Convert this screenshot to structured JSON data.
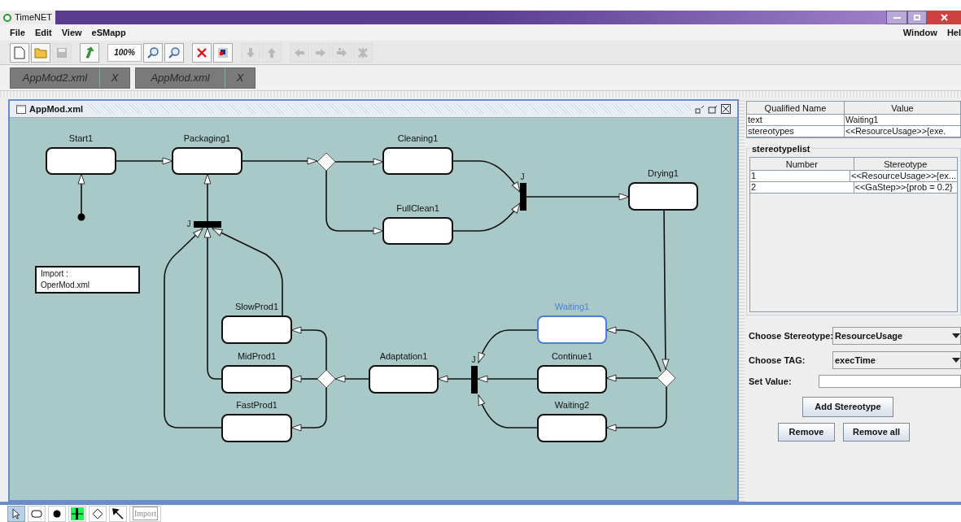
{
  "window": {
    "title": "TimeNET"
  },
  "menu_left": [
    "File",
    "Edit",
    "View",
    "eSMapp"
  ],
  "menu_right": [
    "Window",
    "Hel"
  ],
  "toolbar": [
    {
      "kind": "new",
      "disabled": false
    },
    {
      "kind": "open",
      "disabled": false
    },
    {
      "kind": "save",
      "disabled": true
    },
    {
      "kind": "refresh",
      "disabled": false
    },
    {
      "kind": "zoom",
      "label": "100%",
      "disabled": false
    },
    {
      "kind": "zoom-in",
      "disabled": false
    },
    {
      "kind": "zoom-out",
      "disabled": false
    },
    {
      "kind": "delete",
      "disabled": false
    },
    {
      "kind": "grid",
      "disabled": false
    },
    {
      "kind": "down",
      "disabled": true
    },
    {
      "kind": "up",
      "disabled": true
    },
    {
      "kind": "left",
      "disabled": true
    },
    {
      "kind": "right",
      "disabled": true
    },
    {
      "kind": "link",
      "disabled": true
    },
    {
      "kind": "unlink",
      "disabled": true
    }
  ],
  "tabs": [
    {
      "label": "AppMod2.xml",
      "close": "X"
    },
    {
      "label": "AppMod.xml",
      "close": "X"
    }
  ],
  "frame": {
    "title": "AppMod.xml"
  },
  "diagram": {
    "nodes": [
      {
        "kind": "state",
        "label": "Start1",
        "selected": false
      },
      {
        "kind": "state",
        "label": "Packaging1",
        "selected": false
      },
      {
        "kind": "decision"
      },
      {
        "kind": "state",
        "label": "Cleaning1",
        "selected": false
      },
      {
        "kind": "state",
        "label": "FullClean1",
        "selected": false
      },
      {
        "kind": "join",
        "label": "J"
      },
      {
        "kind": "state",
        "label": "Drying1",
        "selected": false
      },
      {
        "kind": "initial"
      },
      {
        "kind": "join",
        "label": "J"
      },
      {
        "kind": "note",
        "lines": [
          "Import :",
          "OperMod.xml"
        ]
      },
      {
        "kind": "state",
        "label": "SlowProd1",
        "selected": false
      },
      {
        "kind": "state",
        "label": "MidProd1",
        "selected": false
      },
      {
        "kind": "state",
        "label": "FastProd1",
        "selected": false
      },
      {
        "kind": "decision"
      },
      {
        "kind": "state",
        "label": "Adaptation1",
        "selected": false
      },
      {
        "kind": "join",
        "label": "J"
      },
      {
        "kind": "state",
        "label": "Waiting1",
        "selected": true
      },
      {
        "kind": "state",
        "label": "Continue1",
        "selected": false
      },
      {
        "kind": "state",
        "label": "Waiting2",
        "selected": false
      },
      {
        "kind": "decision"
      }
    ]
  },
  "properties": {
    "columns": [
      "Qualified Name",
      "Value"
    ],
    "rows": [
      [
        "text",
        "Waiting1"
      ],
      [
        "stereotypes",
        "<<ResourceUsage>>{exe."
      ]
    ]
  },
  "stereotypelist": {
    "title": "stereotypelist",
    "columns": [
      "Number",
      "Stereotype"
    ],
    "rows": [
      [
        "1",
        "<<ResourceUsage>>{ex..."
      ],
      [
        "2",
        "<<GaStep>>{prob = 0.2}"
      ]
    ]
  },
  "form": {
    "stereotype_label": "Choose Stereotype:",
    "stereotype_value": "ResourceUsage",
    "tag_label": "Choose TAG:",
    "tag_value": "execTime",
    "value_label": "Set Value:",
    "add_button": "Add Stereotype",
    "remove_button": "Remove",
    "remove_all_button": "Remove all"
  },
  "palette": [
    {
      "kind": "pointer",
      "selected": true
    },
    {
      "kind": "state",
      "selected": false
    },
    {
      "kind": "initial",
      "selected": false
    },
    {
      "kind": "join",
      "selected": false
    },
    {
      "kind": "decision",
      "selected": false
    },
    {
      "kind": "arrow",
      "selected": false
    },
    {
      "kind": "import",
      "label": "Import",
      "selected": false
    }
  ]
}
